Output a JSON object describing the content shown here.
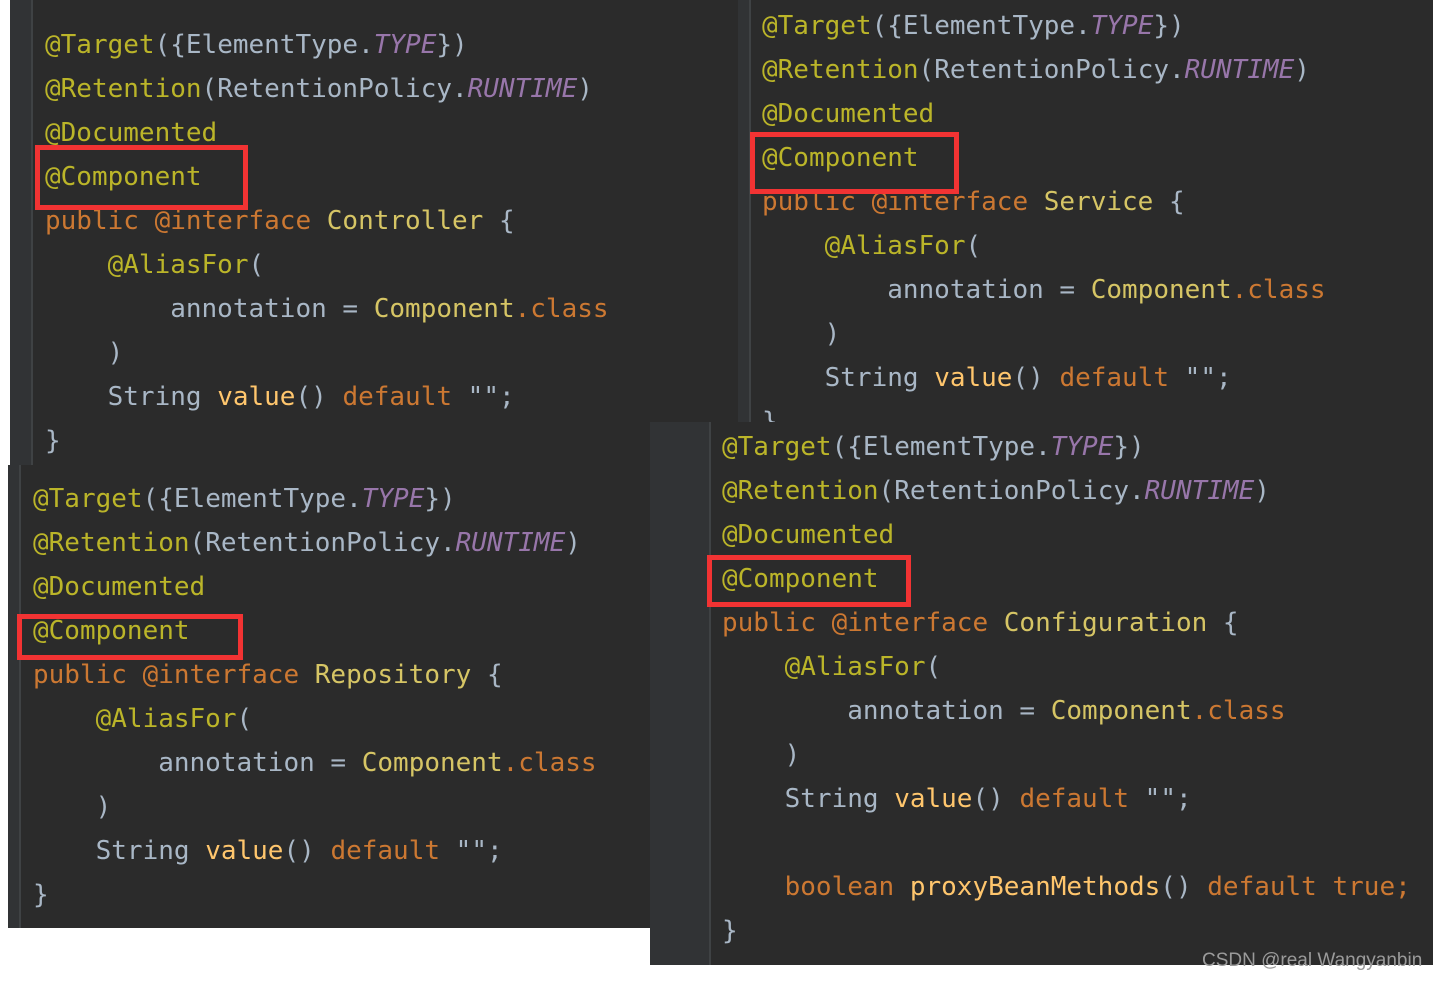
{
  "colors": {
    "background": "#2b2b2b",
    "annotation": "#bbb529",
    "keyword": "#cc7832",
    "constant": "#9876aa",
    "highlight": "#f23333"
  },
  "panels": [
    {
      "name": "controller",
      "lines": [
        [
          [
            "@Target",
            "ann"
          ],
          [
            "({ElementType.",
            "txt"
          ],
          [
            "TYPE",
            "const"
          ],
          [
            "})",
            "txt"
          ]
        ],
        [
          [
            "@Retention",
            "ann"
          ],
          [
            "(RetentionPolicy.",
            "txt"
          ],
          [
            "RUNTIME",
            "const"
          ],
          [
            ")",
            "txt"
          ]
        ],
        [
          [
            "@Documented",
            "ann"
          ]
        ],
        [
          [
            "@Component",
            "ann"
          ]
        ],
        [
          [
            "public @interface ",
            "kw"
          ],
          [
            "Controller",
            "cls"
          ],
          [
            " {",
            "txt"
          ]
        ],
        [
          [
            "    @AliasFor",
            "ann"
          ],
          [
            "(",
            "txt"
          ]
        ],
        [
          [
            "        annotation = ",
            "txt"
          ],
          [
            "Component",
            "cls"
          ],
          [
            ".class",
            "kw"
          ]
        ],
        [
          [
            "    )",
            "txt"
          ]
        ],
        [
          [
            "    String ",
            "txt"
          ],
          [
            "value",
            "mth"
          ],
          [
            "() ",
            "txt"
          ],
          [
            "default ",
            "kw"
          ],
          [
            "\"\";",
            "str"
          ]
        ],
        [
          [
            "}",
            "txt"
          ]
        ]
      ]
    },
    {
      "name": "service",
      "lines": [
        [
          [
            "@Target",
            "ann"
          ],
          [
            "({ElementType.",
            "txt"
          ],
          [
            "TYPE",
            "const"
          ],
          [
            "})",
            "txt"
          ]
        ],
        [
          [
            "@Retention",
            "ann"
          ],
          [
            "(RetentionPolicy.",
            "txt"
          ],
          [
            "RUNTIME",
            "const"
          ],
          [
            ")",
            "txt"
          ]
        ],
        [
          [
            "@Documented",
            "ann"
          ]
        ],
        [
          [
            "@Component",
            "ann"
          ]
        ],
        [
          [
            "public @interface ",
            "kw"
          ],
          [
            "Service",
            "cls"
          ],
          [
            " {",
            "txt"
          ]
        ],
        [
          [
            "    @AliasFor",
            "ann"
          ],
          [
            "(",
            "txt"
          ]
        ],
        [
          [
            "        annotation = ",
            "txt"
          ],
          [
            "Component",
            "cls"
          ],
          [
            ".class",
            "kw"
          ]
        ],
        [
          [
            "    )",
            "txt"
          ]
        ],
        [
          [
            "    String ",
            "txt"
          ],
          [
            "value",
            "mth"
          ],
          [
            "() ",
            "txt"
          ],
          [
            "default ",
            "kw"
          ],
          [
            "\"\";",
            "str"
          ]
        ],
        [
          [
            "}",
            "txt"
          ]
        ]
      ]
    },
    {
      "name": "repository",
      "lines": [
        [
          [
            "@Target",
            "ann"
          ],
          [
            "({ElementType.",
            "txt"
          ],
          [
            "TYPE",
            "const"
          ],
          [
            "})",
            "txt"
          ]
        ],
        [
          [
            "@Retention",
            "ann"
          ],
          [
            "(RetentionPolicy.",
            "txt"
          ],
          [
            "RUNTIME",
            "const"
          ],
          [
            ")",
            "txt"
          ]
        ],
        [
          [
            "@Documented",
            "ann"
          ]
        ],
        [
          [
            "@Component",
            "ann"
          ]
        ],
        [
          [
            "public @interface ",
            "kw"
          ],
          [
            "Repository",
            "cls"
          ],
          [
            " {",
            "txt"
          ]
        ],
        [
          [
            "    @AliasFor",
            "ann"
          ],
          [
            "(",
            "txt"
          ]
        ],
        [
          [
            "        annotation = ",
            "txt"
          ],
          [
            "Component",
            "cls"
          ],
          [
            ".class",
            "kw"
          ]
        ],
        [
          [
            "    )",
            "txt"
          ]
        ],
        [
          [
            "    String ",
            "txt"
          ],
          [
            "value",
            "mth"
          ],
          [
            "() ",
            "txt"
          ],
          [
            "default ",
            "kw"
          ],
          [
            "\"\";",
            "str"
          ]
        ],
        [
          [
            "}",
            "txt"
          ]
        ]
      ]
    },
    {
      "name": "configuration",
      "lines": [
        [
          [
            "@Target",
            "ann"
          ],
          [
            "({ElementType.",
            "txt"
          ],
          [
            "TYPE",
            "const"
          ],
          [
            "})",
            "txt"
          ]
        ],
        [
          [
            "@Retention",
            "ann"
          ],
          [
            "(RetentionPolicy.",
            "txt"
          ],
          [
            "RUNTIME",
            "const"
          ],
          [
            ")",
            "txt"
          ]
        ],
        [
          [
            "@Documented",
            "ann"
          ]
        ],
        [
          [
            "@Component",
            "ann"
          ]
        ],
        [
          [
            "public @interface ",
            "kw"
          ],
          [
            "Configuration",
            "cls"
          ],
          [
            " {",
            "txt"
          ]
        ],
        [
          [
            "    @AliasFor",
            "ann"
          ],
          [
            "(",
            "txt"
          ]
        ],
        [
          [
            "        annotation = ",
            "txt"
          ],
          [
            "Component",
            "cls"
          ],
          [
            ".class",
            "kw"
          ]
        ],
        [
          [
            "    )",
            "txt"
          ]
        ],
        [
          [
            "    String ",
            "txt"
          ],
          [
            "value",
            "mth"
          ],
          [
            "() ",
            "txt"
          ],
          [
            "default ",
            "kw"
          ],
          [
            "\"\";",
            "str"
          ]
        ],
        [
          [
            "",
            "txt"
          ]
        ],
        [
          [
            "    boolean ",
            "kw"
          ],
          [
            "proxyBeanMethods",
            "mth"
          ],
          [
            "() ",
            "txt"
          ],
          [
            "default true;",
            "kw"
          ]
        ],
        [
          [
            "}",
            "txt"
          ]
        ]
      ]
    }
  ],
  "watermark": "CSDN @real Wangyanbin"
}
